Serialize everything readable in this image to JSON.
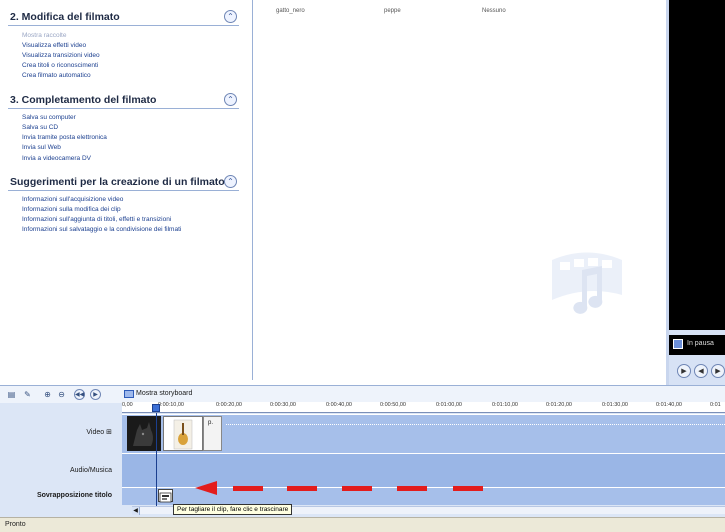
{
  "task_pane": {
    "sections": [
      {
        "title": "2. Modifica del filmato",
        "items": [
          {
            "label": "Mostra raccolte",
            "disabled": true
          },
          {
            "label": "Visualizza effetti video",
            "disabled": false
          },
          {
            "label": "Visualizza transizioni video",
            "disabled": false
          },
          {
            "label": "Crea titoli o riconoscimenti",
            "disabled": false
          },
          {
            "label": "Crea filmato automatico",
            "disabled": false
          }
        ]
      },
      {
        "title": "3. Completamento del filmato",
        "items": [
          {
            "label": "Salva su computer"
          },
          {
            "label": "Salva su CD"
          },
          {
            "label": "Invia tramite posta elettronica"
          },
          {
            "label": "Invia sul Web"
          },
          {
            "label": "Invia a videocamera DV"
          }
        ]
      },
      {
        "title": "Suggerimenti per la creazione di un filmato",
        "items": [
          {
            "label": "Informazioni sull'acquisizione video"
          },
          {
            "label": "Informazioni sulla modifica dei clip"
          },
          {
            "label": "Informazioni sull'aggiunta di titoli, effetti e transizioni"
          },
          {
            "label": "Informazioni sul salvataggio e la condivisione dei filmati"
          }
        ]
      }
    ],
    "collapse_glyph": "⌃"
  },
  "content": {
    "columns": [
      "gatto_nero",
      "peppe",
      "Nessuno"
    ]
  },
  "preview": {
    "status": "In pausa",
    "buttons": [
      "▶",
      "◀",
      "▶"
    ]
  },
  "timeline": {
    "toolbar": {
      "storyboard_label": "Mostra storyboard"
    },
    "ruler_ticks": [
      "0,00",
      "0:00:10,00",
      "0:00:20,00",
      "0:00:30,00",
      "0:00:40,00",
      "0:00:50,00",
      "0:01:00,00",
      "0:01:10,00",
      "0:01:20,00",
      "0:01:30,00",
      "0:01:40,00",
      "0:01"
    ],
    "tracks": {
      "video": "Video",
      "audio": "Audio/Musica",
      "title": "Sovrapposizione titolo"
    },
    "clip_label": "p.",
    "tooltip": "Per tagliare il clip, fare clic e trascinare"
  },
  "status_bar": {
    "text": "Pronto"
  },
  "colors": {
    "accent": "#3b6fd6",
    "arrow": "#e31c1c",
    "track": "#a6bfea"
  }
}
